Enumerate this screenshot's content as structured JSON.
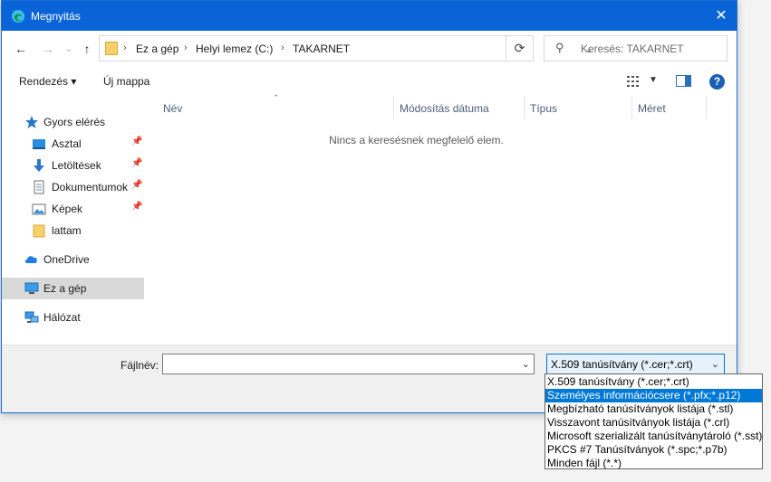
{
  "window": {
    "title": "Megnyitás",
    "close_glyph": "✕"
  },
  "nav": {
    "back_glyph": "←",
    "forward_glyph": "→",
    "recent_glyph": "⌄",
    "up_glyph": "↑",
    "breadcrumbs": [
      "Ez a gép",
      "Helyi lemez (C:)",
      "TAKARNET"
    ],
    "refresh_glyph": "⟳",
    "search_placeholder": "Keresés: TAKARNET"
  },
  "toolbar": {
    "organize_label": "Rendezés ▾",
    "new_folder_label": "Új mappa",
    "help_glyph": "?"
  },
  "sidebar": {
    "items": [
      {
        "label": "Gyors elérés",
        "icon": "star-icon"
      },
      {
        "label": "Asztal",
        "icon": "desktop-icon",
        "pinned": true
      },
      {
        "label": "Letöltések",
        "icon": "download-icon",
        "pinned": true
      },
      {
        "label": "Dokumentumok",
        "icon": "document-icon",
        "pinned": true
      },
      {
        "label": "Képek",
        "icon": "pictures-icon",
        "pinned": true
      },
      {
        "label": "lattam",
        "icon": "folder-icon"
      },
      {
        "label": "OneDrive",
        "icon": "cloud-icon"
      },
      {
        "label": "Ez a gép",
        "icon": "computer-icon",
        "selected": true
      },
      {
        "label": "Hálózat",
        "icon": "network-icon"
      }
    ]
  },
  "columns": [
    "Név",
    "Módosítás dátuma",
    "Típus",
    "Méret"
  ],
  "empty_message": "Nincs a keresésnek megfelelő elem.",
  "bottom": {
    "filename_label": "Fájlnév:",
    "filename_value": "",
    "filetype_selected": "X.509 tanúsítvány (*.cer;*.crt)"
  },
  "filetype_options": [
    "X.509 tanúsítvány (*.cer;*.crt)",
    "Személyes információcsere (*.pfx;*.p12)",
    "Megbízható tanúsítványok listája (*.stl)",
    "Visszavont tanúsítványok listája (*.crl)",
    "Microsoft szerializált tanúsítványtároló (*.sst)",
    "PKCS #7 Tanúsítványok (*.spc;*.p7b)",
    "Minden fájl (*.*)"
  ],
  "filetype_highlighted_index": 1,
  "colors": {
    "titlebar": "#0a64d8",
    "selection": "#0078d7",
    "nav_selected": "#d9d9d9"
  }
}
